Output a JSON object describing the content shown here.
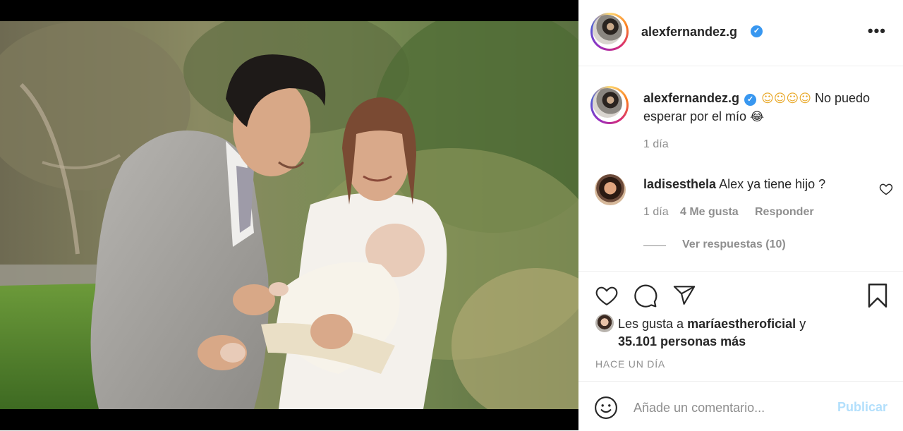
{
  "post": {
    "username": "alexfernandez.g",
    "verified_glyph": "✓",
    "more_options": "•••"
  },
  "caption": {
    "username": "alexfernandez.g",
    "emojis_1": "☺☺☺☺",
    "text": "No puedo esperar por el mío",
    "emoji_2": "😂",
    "time": "1 día"
  },
  "comments": [
    {
      "username": "ladisesthela",
      "text": "Alex ya tiene hijo ?",
      "time": "1 día",
      "likes": "4 Me gusta",
      "reply": "Responder",
      "view_replies": "Ver respuestas (10)"
    }
  ],
  "likes": {
    "prefix": "Les gusta a",
    "user": "maríaestheroficial",
    "conjunction": "y",
    "others": "35.101 personas más"
  },
  "timestamp": "HACE UN DÍA",
  "comment_box": {
    "placeholder": "Añade un comentario...",
    "publish": "Publicar"
  },
  "icons": {
    "like": "heart-icon",
    "comment": "comment-icon",
    "share": "paper-plane-icon",
    "save": "bookmark-icon",
    "emoji": "smiley-icon",
    "more": "more-options-icon"
  },
  "colors": {
    "verified": "#3897f0",
    "muted": "#8e8e8e",
    "publish_disabled": "#b2dffc",
    "text": "#262626"
  }
}
